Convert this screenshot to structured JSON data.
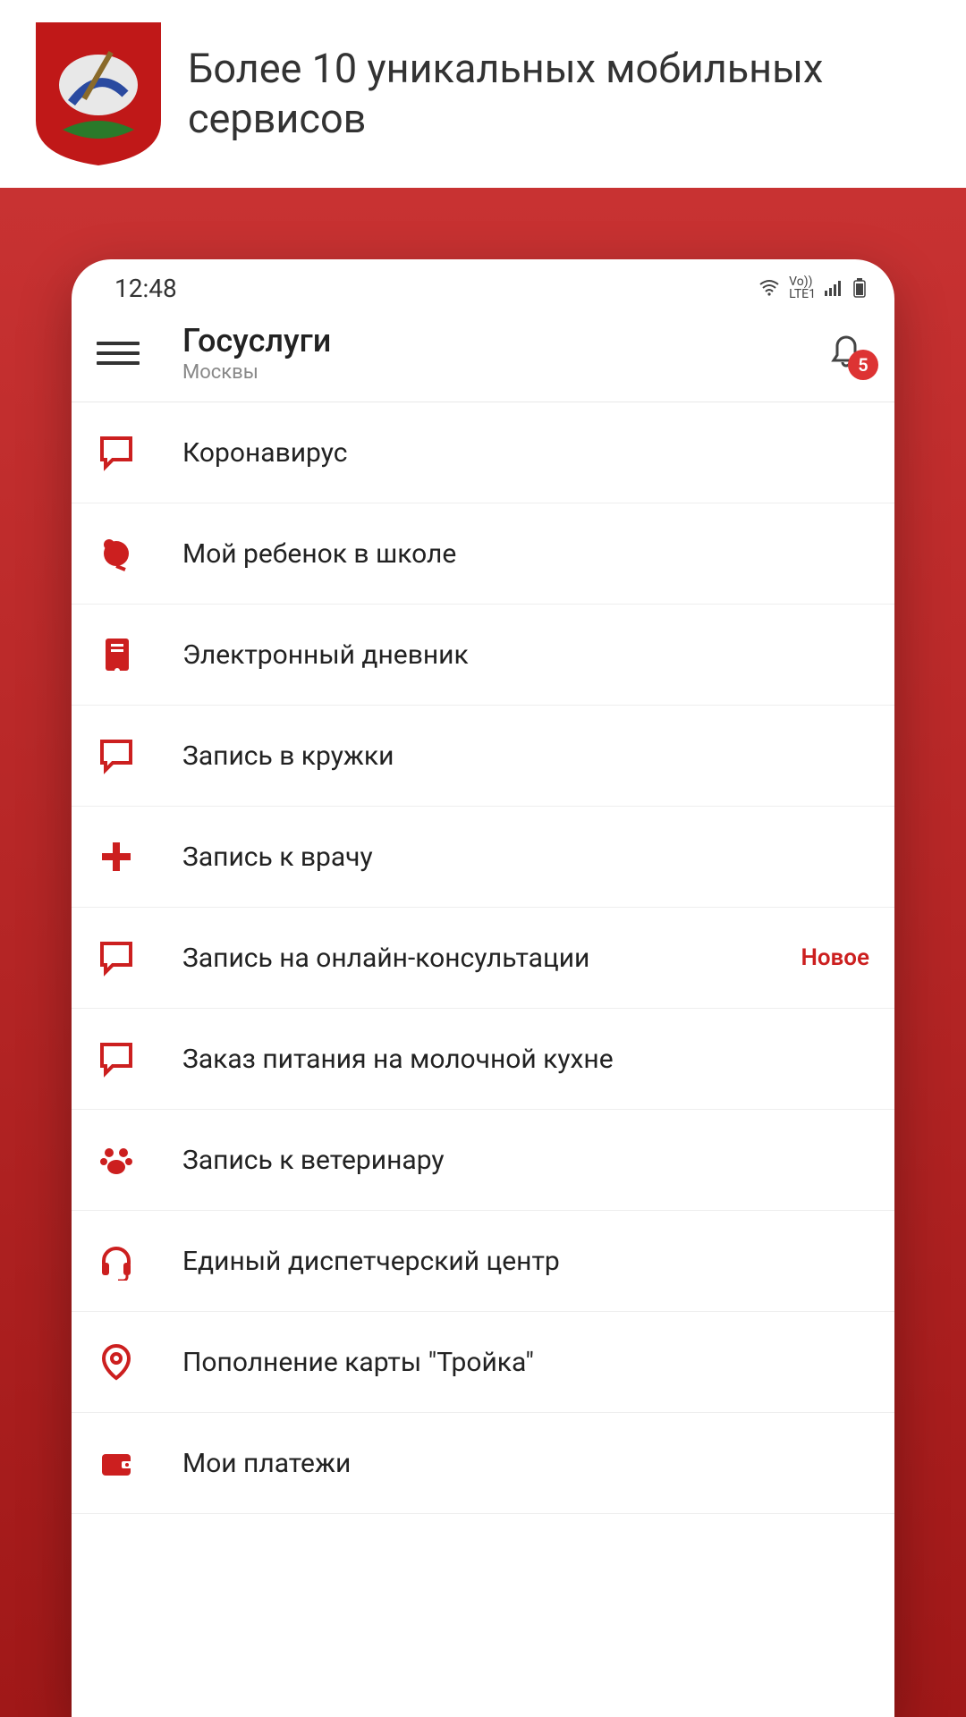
{
  "banner": {
    "text": "Более 10 уникальных мобильных сервисов"
  },
  "status": {
    "time": "12:48"
  },
  "header": {
    "title": "Госуслуги",
    "subtitle": "Москвы",
    "badge": "5"
  },
  "items": [
    {
      "label": "Коронавирус",
      "icon": "chat"
    },
    {
      "label": "Мой ребенок в школе",
      "icon": "bell-alarm"
    },
    {
      "label": "Электронный дневник",
      "icon": "notebook"
    },
    {
      "label": "Запись в кружки",
      "icon": "chat"
    },
    {
      "label": "Запись к врачу",
      "icon": "medical"
    },
    {
      "label": "Запись на онлайн-консультации",
      "icon": "chat",
      "badge": "Новое"
    },
    {
      "label": "Заказ питания на молочной кухне",
      "icon": "chat"
    },
    {
      "label": "Запись к ветеринару",
      "icon": "paw"
    },
    {
      "label": "Единый диспетчерский центр",
      "icon": "headset"
    },
    {
      "label": "Пополнение карты \"Тройка\"",
      "icon": "pin"
    },
    {
      "label": "Мои платежи",
      "icon": "wallet"
    }
  ]
}
